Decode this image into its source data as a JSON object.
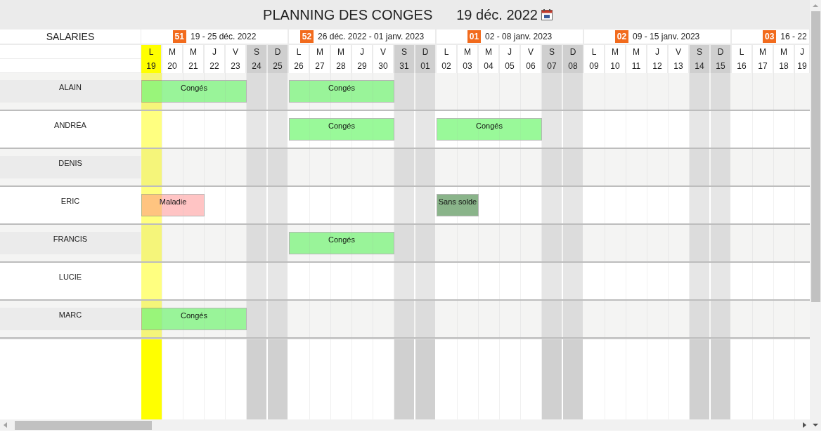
{
  "title": "PLANNING DES CONGES",
  "current_date": "19 déc. 2022",
  "employees_header": "SALARIES",
  "weeks": [
    {
      "number": "51",
      "label": "19 - 25 déc. 2022"
    },
    {
      "number": "52",
      "label": "26 déc. 2022 - 01 janv. 2023"
    },
    {
      "number": "01",
      "label": "02 - 08 janv. 2023"
    },
    {
      "number": "02",
      "label": "09 - 15 janv. 2023"
    },
    {
      "number": "03",
      "label": "16 - 22"
    }
  ],
  "days": [
    {
      "letter": "L",
      "date": "19",
      "weekend": false,
      "today": true
    },
    {
      "letter": "M",
      "date": "20",
      "weekend": false,
      "today": false
    },
    {
      "letter": "M",
      "date": "21",
      "weekend": false,
      "today": false
    },
    {
      "letter": "J",
      "date": "22",
      "weekend": false,
      "today": false
    },
    {
      "letter": "V",
      "date": "23",
      "weekend": false,
      "today": false
    },
    {
      "letter": "S",
      "date": "24",
      "weekend": true,
      "today": false
    },
    {
      "letter": "D",
      "date": "25",
      "weekend": true,
      "today": false
    },
    {
      "letter": "L",
      "date": "26",
      "weekend": false,
      "today": false
    },
    {
      "letter": "M",
      "date": "27",
      "weekend": false,
      "today": false
    },
    {
      "letter": "M",
      "date": "28",
      "weekend": false,
      "today": false
    },
    {
      "letter": "J",
      "date": "29",
      "weekend": false,
      "today": false
    },
    {
      "letter": "V",
      "date": "30",
      "weekend": false,
      "today": false
    },
    {
      "letter": "S",
      "date": "31",
      "weekend": true,
      "today": false
    },
    {
      "letter": "D",
      "date": "01",
      "weekend": true,
      "today": false
    },
    {
      "letter": "L",
      "date": "02",
      "weekend": false,
      "today": false
    },
    {
      "letter": "M",
      "date": "03",
      "weekend": false,
      "today": false
    },
    {
      "letter": "M",
      "date": "04",
      "weekend": false,
      "today": false
    },
    {
      "letter": "J",
      "date": "05",
      "weekend": false,
      "today": false
    },
    {
      "letter": "V",
      "date": "06",
      "weekend": false,
      "today": false
    },
    {
      "letter": "S",
      "date": "07",
      "weekend": true,
      "today": false
    },
    {
      "letter": "D",
      "date": "08",
      "weekend": true,
      "today": false
    },
    {
      "letter": "L",
      "date": "09",
      "weekend": false,
      "today": false
    },
    {
      "letter": "M",
      "date": "10",
      "weekend": false,
      "today": false
    },
    {
      "letter": "M",
      "date": "11",
      "weekend": false,
      "today": false
    },
    {
      "letter": "J",
      "date": "12",
      "weekend": false,
      "today": false
    },
    {
      "letter": "V",
      "date": "13",
      "weekend": false,
      "today": false
    },
    {
      "letter": "S",
      "date": "14",
      "weekend": true,
      "today": false
    },
    {
      "letter": "D",
      "date": "15",
      "weekend": true,
      "today": false
    },
    {
      "letter": "L",
      "date": "16",
      "weekend": false,
      "today": false
    },
    {
      "letter": "M",
      "date": "17",
      "weekend": false,
      "today": false
    },
    {
      "letter": "M",
      "date": "18",
      "weekend": false,
      "today": false
    },
    {
      "letter": "J",
      "date": "19",
      "weekend": false,
      "today": false
    }
  ],
  "employees": [
    {
      "name": "ALAIN",
      "cells": [
        {
          "kind": "absence",
          "label": "Congés",
          "color": "#99f999"
        },
        {
          "kind": "continued"
        },
        {
          "kind": "continued"
        },
        {
          "kind": "continued"
        },
        {
          "kind": "continued"
        },
        {
          "kind": "free"
        },
        {
          "kind": "free"
        },
        {
          "kind": "absence",
          "label": "Congés",
          "color": "#99f999"
        },
        {
          "kind": "continued"
        },
        {
          "kind": "continued"
        },
        {
          "kind": "continued"
        },
        {
          "kind": "continued"
        }
      ]
    },
    {
      "name": "ANDRÉA",
      "cells": [
        {
          "kind": "free"
        },
        {
          "kind": "free"
        },
        {
          "kind": "free"
        },
        {
          "kind": "free"
        },
        {
          "kind": "free"
        },
        {
          "kind": "free"
        },
        {
          "kind": "free"
        },
        {
          "kind": "absence",
          "label": "Congés",
          "color": "#99f999"
        },
        {
          "kind": "continued"
        },
        {
          "kind": "continued"
        },
        {
          "kind": "continued"
        },
        {
          "kind": "continued"
        },
        {
          "kind": "free"
        },
        {
          "kind": "free"
        },
        {
          "kind": "absence",
          "label": "Congés",
          "color": "#99f999"
        },
        {
          "kind": "continued"
        },
        {
          "kind": "continued"
        },
        {
          "kind": "continued"
        },
        {
          "kind": "continued"
        }
      ]
    },
    {
      "name": "DENIS"
    },
    {
      "name": "ERIC",
      "cells": [
        {
          "kind": "absence",
          "label": "Maladie",
          "color": "#ffc4c4"
        },
        {
          "kind": "continued"
        },
        {
          "kind": "continued"
        },
        {
          "kind": "free"
        },
        {
          "kind": "free"
        },
        {
          "kind": "free"
        },
        {
          "kind": "free"
        },
        {
          "kind": "free"
        },
        {
          "kind": "free"
        },
        {
          "kind": "free"
        },
        {
          "kind": "free"
        },
        {
          "kind": "free"
        },
        {
          "kind": "free"
        },
        {
          "kind": "free"
        },
        {
          "kind": "absence",
          "label": "Sans solde",
          "color": "#8ab48a"
        },
        {
          "kind": "continued"
        }
      ]
    },
    {
      "name": "FRANCIS",
      "cells": [
        {
          "kind": "free"
        },
        {
          "kind": "free"
        },
        {
          "kind": "free"
        },
        {
          "kind": "free"
        },
        {
          "kind": "free"
        },
        {
          "kind": "free"
        },
        {
          "kind": "free"
        },
        {
          "kind": "absence",
          "label": "Congés",
          "color": "#99f999"
        },
        {
          "kind": "continued"
        },
        {
          "kind": "continued"
        },
        {
          "kind": "continued"
        },
        {
          "kind": "continued"
        }
      ]
    },
    {
      "name": "LUCIE"
    },
    {
      "name": "MARC",
      "cells": [
        {
          "kind": "absence",
          "label": "Congés",
          "color": "#99f999"
        },
        {
          "kind": "continued"
        },
        {
          "kind": "continued"
        },
        {
          "kind": "continued"
        },
        {
          "kind": "continued"
        }
      ]
    }
  ]
}
